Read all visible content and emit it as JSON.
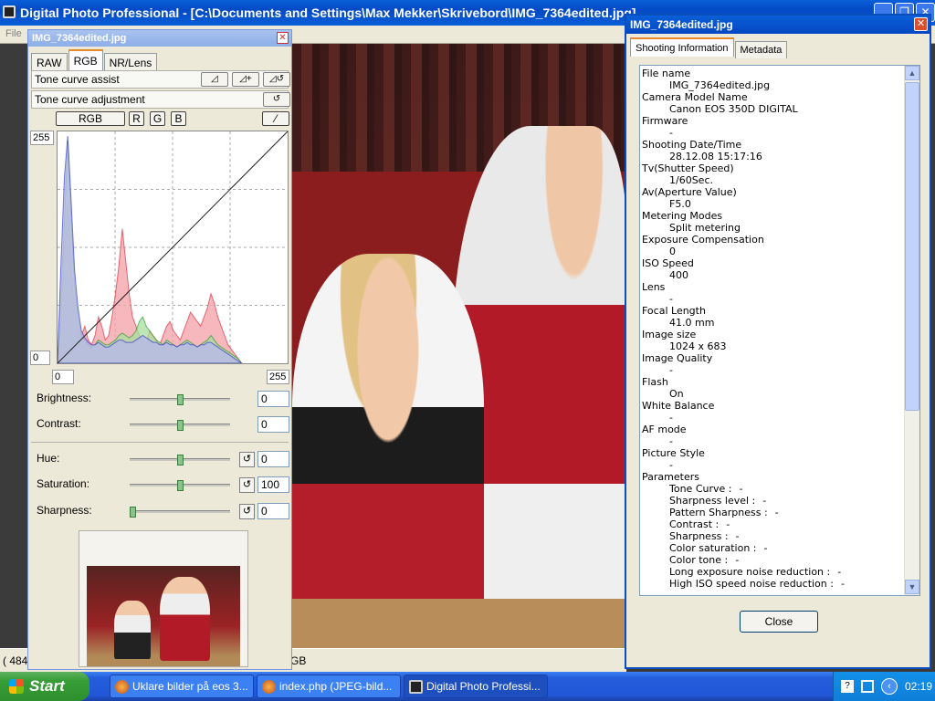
{
  "app": {
    "title": "Digital Photo Professional - [C:\\Documents and Settings\\Max Mekker\\Skrivebord\\IMG_7364edited.jpg]",
    "menu_file": "File",
    "status_left": "( 484",
    "status_right": "GB"
  },
  "palette": {
    "title": "IMG_7364edited.jpg",
    "tabs": [
      "RAW",
      "RGB",
      "NR/Lens"
    ],
    "active_tab": "RGB",
    "tone_curve_assist": "Tone curve assist",
    "tone_curve_adjustment": "Tone curve adjustment",
    "channels": {
      "rgb": "RGB",
      "r": "R",
      "g": "G",
      "b": "B"
    },
    "curve": {
      "y_max_label": "255",
      "y_min_label": "0",
      "x_min_value": "0",
      "x_max_value": "255",
      "red_histogram": [
        0,
        18,
        46,
        70,
        40,
        22,
        14,
        12,
        16,
        10,
        8,
        12,
        20,
        16,
        10,
        12,
        20,
        30,
        42,
        58,
        44,
        30,
        20,
        16,
        12,
        10,
        8,
        14,
        12,
        10,
        8,
        12,
        16,
        18,
        14,
        12,
        10,
        14,
        18,
        22,
        20,
        18,
        16,
        20,
        24,
        30,
        26,
        20,
        16,
        12,
        8,
        6,
        4,
        2,
        0
      ],
      "green_histogram": [
        0,
        30,
        60,
        96,
        62,
        34,
        20,
        12,
        10,
        8,
        7,
        8,
        10,
        9,
        8,
        8,
        9,
        10,
        12,
        13,
        12,
        11,
        12,
        14,
        18,
        20,
        16,
        14,
        12,
        10,
        9,
        8,
        10,
        9,
        8,
        7,
        8,
        9,
        10,
        9,
        8,
        7,
        8,
        9,
        10,
        12,
        10,
        8,
        7,
        6,
        5,
        4,
        3,
        2,
        0
      ],
      "blue_histogram": [
        0,
        42,
        80,
        98,
        70,
        40,
        24,
        14,
        11,
        9,
        8,
        8,
        9,
        8,
        7,
        7,
        8,
        9,
        10,
        10,
        9,
        9,
        9,
        10,
        11,
        12,
        11,
        10,
        9,
        9,
        8,
        8,
        9,
        8,
        8,
        7,
        8,
        8,
        9,
        8,
        8,
        7,
        8,
        8,
        9,
        9,
        8,
        7,
        6,
        5,
        4,
        3,
        2,
        1,
        0
      ]
    },
    "sliders": [
      {
        "label": "Brightness:",
        "value": "0",
        "level": 0.5
      },
      {
        "label": "Contrast:",
        "value": "0",
        "level": 0.5
      },
      {
        "label": "Hue:",
        "value": "0",
        "level": 0.5
      },
      {
        "label": "Saturation:",
        "value": "100",
        "level": 0.5
      },
      {
        "label": "Sharpness:",
        "value": "0",
        "level": 0.0
      }
    ]
  },
  "info": {
    "title": "IMG_7364edited.jpg",
    "tabs": [
      "Shooting Information",
      "Metadata"
    ],
    "active_tab": "Shooting Information",
    "rows": [
      {
        "label": "File name",
        "value": "IMG_7364edited.jpg"
      },
      {
        "label": "Camera Model Name",
        "value": "Canon EOS 350D DIGITAL"
      },
      {
        "label": "Firmware",
        "value": "-"
      },
      {
        "label": "Shooting Date/Time",
        "value": "28.12.08 15:17:16"
      },
      {
        "label": "Tv(Shutter Speed)",
        "value": "1/60Sec."
      },
      {
        "label": "Av(Aperture Value)",
        "value": "F5.0"
      },
      {
        "label": "Metering Modes",
        "value": "Split metering"
      },
      {
        "label": "Exposure Compensation",
        "value": "0"
      },
      {
        "label": "ISO Speed",
        "value": "400"
      },
      {
        "label": "Lens",
        "value": "-"
      },
      {
        "label": "Focal Length",
        "value": "41.0 mm"
      },
      {
        "label": "Image size",
        "value": "1024 x 683"
      },
      {
        "label": "Image Quality",
        "value": "-"
      },
      {
        "label": "Flash",
        "value": "On"
      },
      {
        "label": "White Balance",
        "value": "-"
      },
      {
        "label": "AF mode",
        "value": "-"
      },
      {
        "label": "Picture Style",
        "value": "-"
      },
      {
        "label": "Parameters",
        "value": ""
      }
    ],
    "parameters": [
      {
        "label": "Tone Curve :",
        "value": "-"
      },
      {
        "label": "Sharpness level :",
        "value": "-"
      },
      {
        "label": "Pattern Sharpness :",
        "value": "-"
      },
      {
        "label": "Contrast :",
        "value": "-"
      },
      {
        "label": "Sharpness :",
        "value": "-"
      },
      {
        "label": "Color saturation :",
        "value": "-"
      },
      {
        "label": "Color tone :",
        "value": "-"
      },
      {
        "label": "Long exposure noise reduction :",
        "value": "-"
      },
      {
        "label": "High ISO speed noise reduction :",
        "value": "-"
      }
    ],
    "close_label": "Close"
  },
  "taskbar": {
    "start_label": "Start",
    "tasks": [
      {
        "label": "Uklare bilder på eos 3...",
        "active": false
      },
      {
        "label": "index.php (JPEG-bild...",
        "active": false
      },
      {
        "label": "Digital Photo Professi...",
        "active": true
      }
    ],
    "clock": "02:19"
  }
}
